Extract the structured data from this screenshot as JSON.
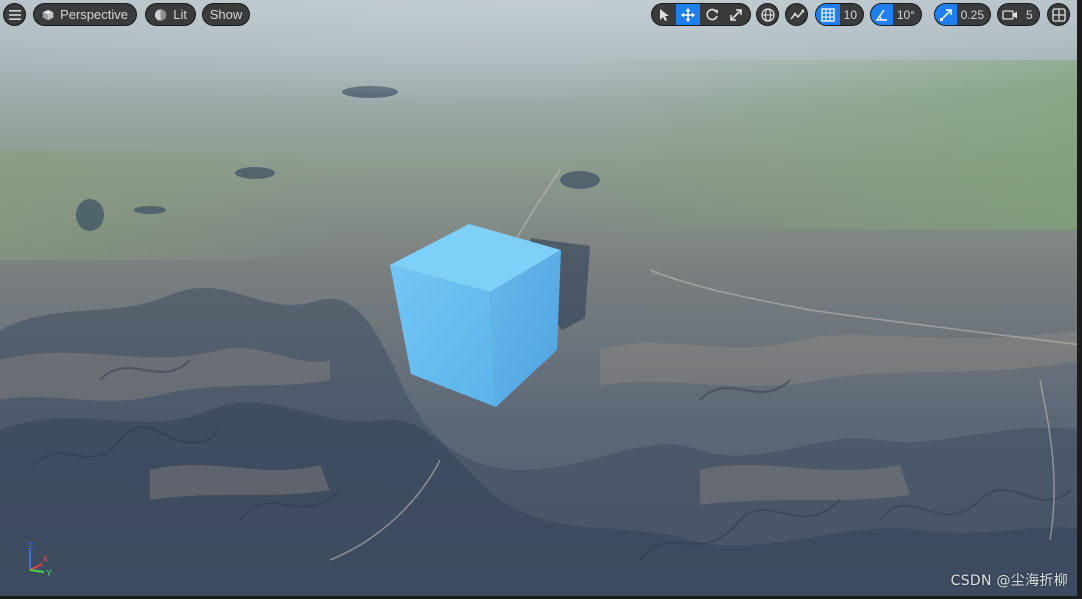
{
  "toolbar": {
    "menu_icon": "hamburger-menu-icon",
    "view_mode_label": "Perspective",
    "lighting_label": "Lit",
    "show_label": "Show",
    "grid_snap_value": "10",
    "rotation_snap_value": "10°",
    "scale_snap_value": "0.25",
    "camera_speed_value": "5",
    "active_transform_tool": "translate",
    "accent_color": "#1f7ff0"
  },
  "axis_gizmo": {
    "x_label": "X",
    "y_label": "Y",
    "z_label": "Z",
    "x_color": "#e84040",
    "y_color": "#4fd04f",
    "z_color": "#3a6df0"
  },
  "scene": {
    "object": "cube",
    "object_color": "#62b8f0"
  },
  "watermark": "CSDN @尘海折柳"
}
